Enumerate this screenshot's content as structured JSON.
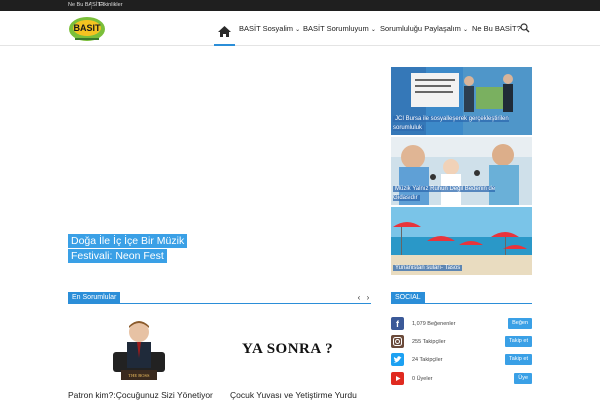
{
  "topbar": {
    "link1": "Ne Bu BASİT?",
    "link2": "Etkinlikler"
  },
  "nav": {
    "item1": "BASİT Sosyalim",
    "item2": "BASİT Sorumluyum",
    "item3": "Sorumluluğu Paylaşalım",
    "item4": "Ne Bu BASİT?"
  },
  "slider": {
    "title": "Doğa İle İç İçe Bir Müzik Festivali: Neon Fest"
  },
  "side_posts": [
    {
      "caption": "JCI Bursa ile sosyalleşerek gerçekleştirilen sorumluluk"
    },
    {
      "caption": "Müzik Yalnız Ruhun Değil Bedenin de Gıdasıdır"
    },
    {
      "caption": "Yunanistan suları- Tasos"
    }
  ],
  "section": {
    "title": "En Sorumlular",
    "prev": "‹",
    "next": "›"
  },
  "cards": [
    {
      "title": "Patron kim?:Çocuğunuz Sizi Yönetiyor",
      "image_text": "THE BOSS"
    },
    {
      "title": "Çocuk Yuvası ve Yetiştirme Yurdu",
      "image_text": "YA SONRA ?"
    }
  ],
  "social": {
    "title": "SOCIAL",
    "rows": [
      {
        "network": "facebook",
        "count": "1,079 Beğenenler",
        "button": "Beğen",
        "color": "#3b5998"
      },
      {
        "network": "instagram",
        "count": "255 Takipçiler",
        "button": "Takip et",
        "color": "#6b4a3a"
      },
      {
        "network": "twitter",
        "count": "24 Takipçiler",
        "button": "Takip et",
        "color": "#1da1f2"
      },
      {
        "network": "youtube",
        "count": "0 Üyeler",
        "button": "Üye",
        "color": "#e02a20"
      }
    ]
  },
  "colors": {
    "accent": "#2b8ed8",
    "topbar": "#1f1f1f"
  }
}
